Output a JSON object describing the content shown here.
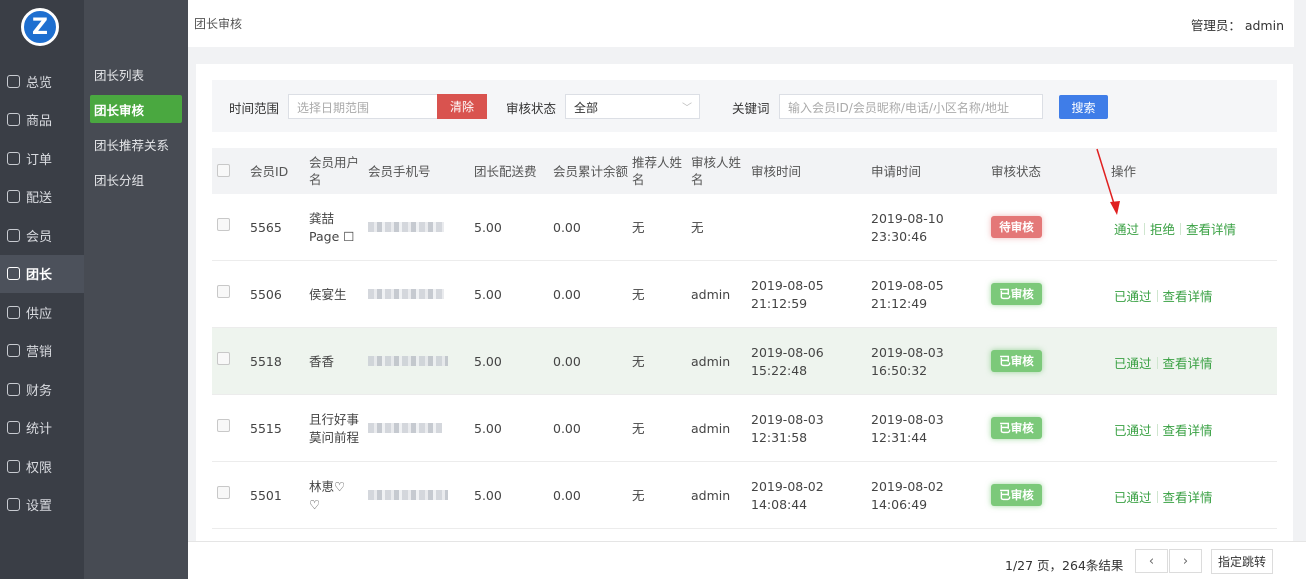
{
  "logo": {
    "letter": "Z"
  },
  "nav": [
    {
      "label": "总览",
      "icon": "home-icon"
    },
    {
      "label": "商品",
      "icon": "goods-icon"
    },
    {
      "label": "订单",
      "icon": "order-icon"
    },
    {
      "label": "配送",
      "icon": "delivery-icon"
    },
    {
      "label": "会员",
      "icon": "member-icon"
    },
    {
      "label": "团长",
      "icon": "leader-icon",
      "active": true
    },
    {
      "label": "供应",
      "icon": "supply-icon"
    },
    {
      "label": "营销",
      "icon": "marketing-icon"
    },
    {
      "label": "财务",
      "icon": "finance-icon"
    },
    {
      "label": "统计",
      "icon": "stats-icon"
    },
    {
      "label": "权限",
      "icon": "permission-icon"
    },
    {
      "label": "设置",
      "icon": "settings-icon"
    }
  ],
  "subnav": [
    {
      "label": "团长列表"
    },
    {
      "label": "团长审核",
      "active": true
    },
    {
      "label": "团长推荐关系"
    },
    {
      "label": "团长分组"
    }
  ],
  "header": {
    "title": "团长审核",
    "admin": "管理员： admin"
  },
  "filter": {
    "time_label": "时间范围",
    "date_placeholder": "选择日期范围",
    "clear": "清除",
    "status_label": "审核状态",
    "status_value": "全部",
    "keyword_label": "关键词",
    "keyword_placeholder": "输入会员ID/会员昵称/电话/小区名称/地址",
    "search": "搜索"
  },
  "columns": {
    "id": "会员ID",
    "username": "会员用户名",
    "phone": "会员手机号",
    "fee": "团长配送费",
    "balance": "会员累计余额",
    "referrer": "推荐人姓名",
    "auditor": "审核人姓名",
    "audit_time": "审核时间",
    "apply_time": "申请时间",
    "status": "审核状态",
    "ops": "操作"
  },
  "rows": [
    {
      "id": "5565",
      "name1": "龚喆",
      "name2": "Page ☐",
      "fee": "5.00",
      "balance": "0.00",
      "referrer": "无",
      "auditor": "无",
      "audit_date": "",
      "audit_clock": "",
      "apply_date": "2019-08-10",
      "apply_clock": "23:30:46",
      "status": "待审核",
      "pending": true,
      "act1": "通过",
      "act2": "拒绝",
      "act3": "查看详情"
    },
    {
      "id": "5506",
      "name1": "侯宴生",
      "name2": "",
      "fee": "5.00",
      "balance": "0.00",
      "referrer": "无",
      "auditor": "admin",
      "audit_date": "2019-08-05",
      "audit_clock": "21:12:59",
      "apply_date": "2019-08-05",
      "apply_clock": "21:12:49",
      "status": "已审核",
      "pending": false,
      "act1": "已通过",
      "act2": "查看详情"
    },
    {
      "id": "5518",
      "name1": "香香",
      "name2": "",
      "fee": "5.00",
      "balance": "0.00",
      "referrer": "无",
      "auditor": "admin",
      "audit_date": "2019-08-06",
      "audit_clock": "15:22:48",
      "apply_date": "2019-08-03",
      "apply_clock": "16:50:32",
      "status": "已审核",
      "pending": false,
      "act1": "已通过",
      "act2": "查看详情"
    },
    {
      "id": "5515",
      "name1": "且行好事",
      "name2": "莫问前程",
      "fee": "5.00",
      "balance": "0.00",
      "referrer": "无",
      "auditor": "admin",
      "audit_date": "2019-08-03",
      "audit_clock": "12:31:58",
      "apply_date": "2019-08-03",
      "apply_clock": "12:31:44",
      "status": "已审核",
      "pending": false,
      "act1": "已通过",
      "act2": "查看详情"
    },
    {
      "id": "5501",
      "name1": "林恵♡",
      "name2": "♡",
      "fee": "5.00",
      "balance": "0.00",
      "referrer": "无",
      "auditor": "admin",
      "audit_date": "2019-08-02",
      "audit_clock": "14:08:44",
      "apply_date": "2019-08-02",
      "apply_clock": "14:06:49",
      "status": "已审核",
      "pending": false,
      "act1": "已通过",
      "act2": "查看详情"
    }
  ],
  "pagination": {
    "info": "1/27 页，264条结果",
    "prev": "‹",
    "next": "›",
    "jump": "指定跳转"
  },
  "colors": {
    "accent": "#4aa840",
    "danger": "#d9534f",
    "primary": "#3f7de8",
    "sidebar": "#3a3e46"
  }
}
